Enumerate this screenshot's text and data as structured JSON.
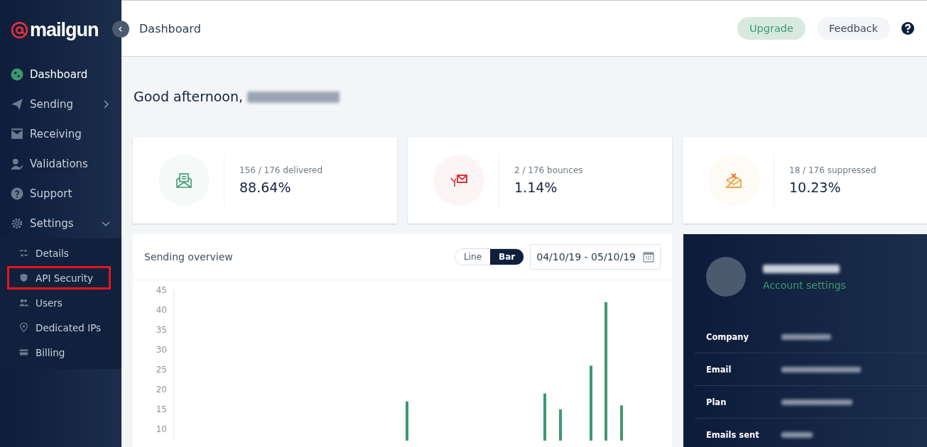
{
  "sidebar": {
    "logo": "mailgun",
    "items": [
      {
        "label": "Dashboard",
        "selected": true
      },
      {
        "label": "Sending",
        "selected": false,
        "expanded": false,
        "kind": "group"
      },
      {
        "label": "Receiving",
        "selected": false
      },
      {
        "label": "Validations",
        "selected": false
      },
      {
        "label": "Support",
        "selected": false
      },
      {
        "label": "Settings",
        "selected": false,
        "expanded": true,
        "kind": "group",
        "children": [
          {
            "label": "Details",
            "highlighted": false
          },
          {
            "label": "API Security",
            "highlighted": true
          },
          {
            "label": "Users",
            "highlighted": false
          },
          {
            "label": "Dedicated IPs",
            "highlighted": false
          },
          {
            "label": "Billing",
            "highlighted": false
          }
        ]
      }
    ]
  },
  "header": {
    "title": "Dashboard",
    "buttons": [
      {
        "label": "Upgrade",
        "kind": "primary"
      },
      {
        "label": "Feedback",
        "kind": "plain"
      }
    ]
  },
  "greeting": "Good afternoon,",
  "stats": [
    {
      "label": "156 / 176 delivered",
      "value": "88.64%",
      "color": "#3d9970"
    },
    {
      "label": "2 / 176 bounces",
      "value": "1.14%",
      "color": "#e0303a"
    },
    {
      "label": "18 / 176 suppressed",
      "value": "10.23%",
      "color": "#f5a142"
    }
  ],
  "overview": {
    "title": "Sending overview",
    "modes": [
      {
        "label": "Line",
        "selected": false
      },
      {
        "label": "Bar",
        "selected": true
      }
    ],
    "date_range": "04/10/19 - 05/10/19",
    "y_axis_labels": [
      "45",
      "40",
      "35",
      "30",
      "25",
      "20",
      "15",
      "10"
    ]
  },
  "profile": {
    "link": "Account settings",
    "rows": [
      {
        "label": "Company"
      },
      {
        "label": "Email"
      },
      {
        "label": "Plan"
      },
      {
        "label": "Emails sent"
      }
    ]
  }
}
